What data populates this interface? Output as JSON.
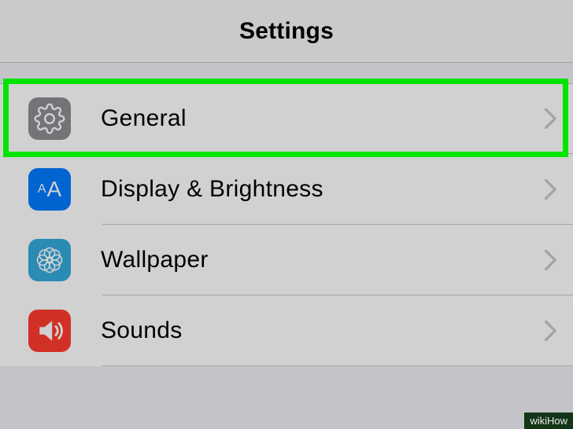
{
  "header": {
    "title": "Settings"
  },
  "rows": {
    "general": {
      "label": "General",
      "icon": "gear-icon"
    },
    "display": {
      "label": "Display & Brightness",
      "icon": "text-size-icon"
    },
    "wallpaper": {
      "label": "Wallpaper",
      "icon": "flower-icon"
    },
    "sounds": {
      "label": "Sounds",
      "icon": "speaker-icon"
    }
  },
  "watermark": "wikiHow"
}
